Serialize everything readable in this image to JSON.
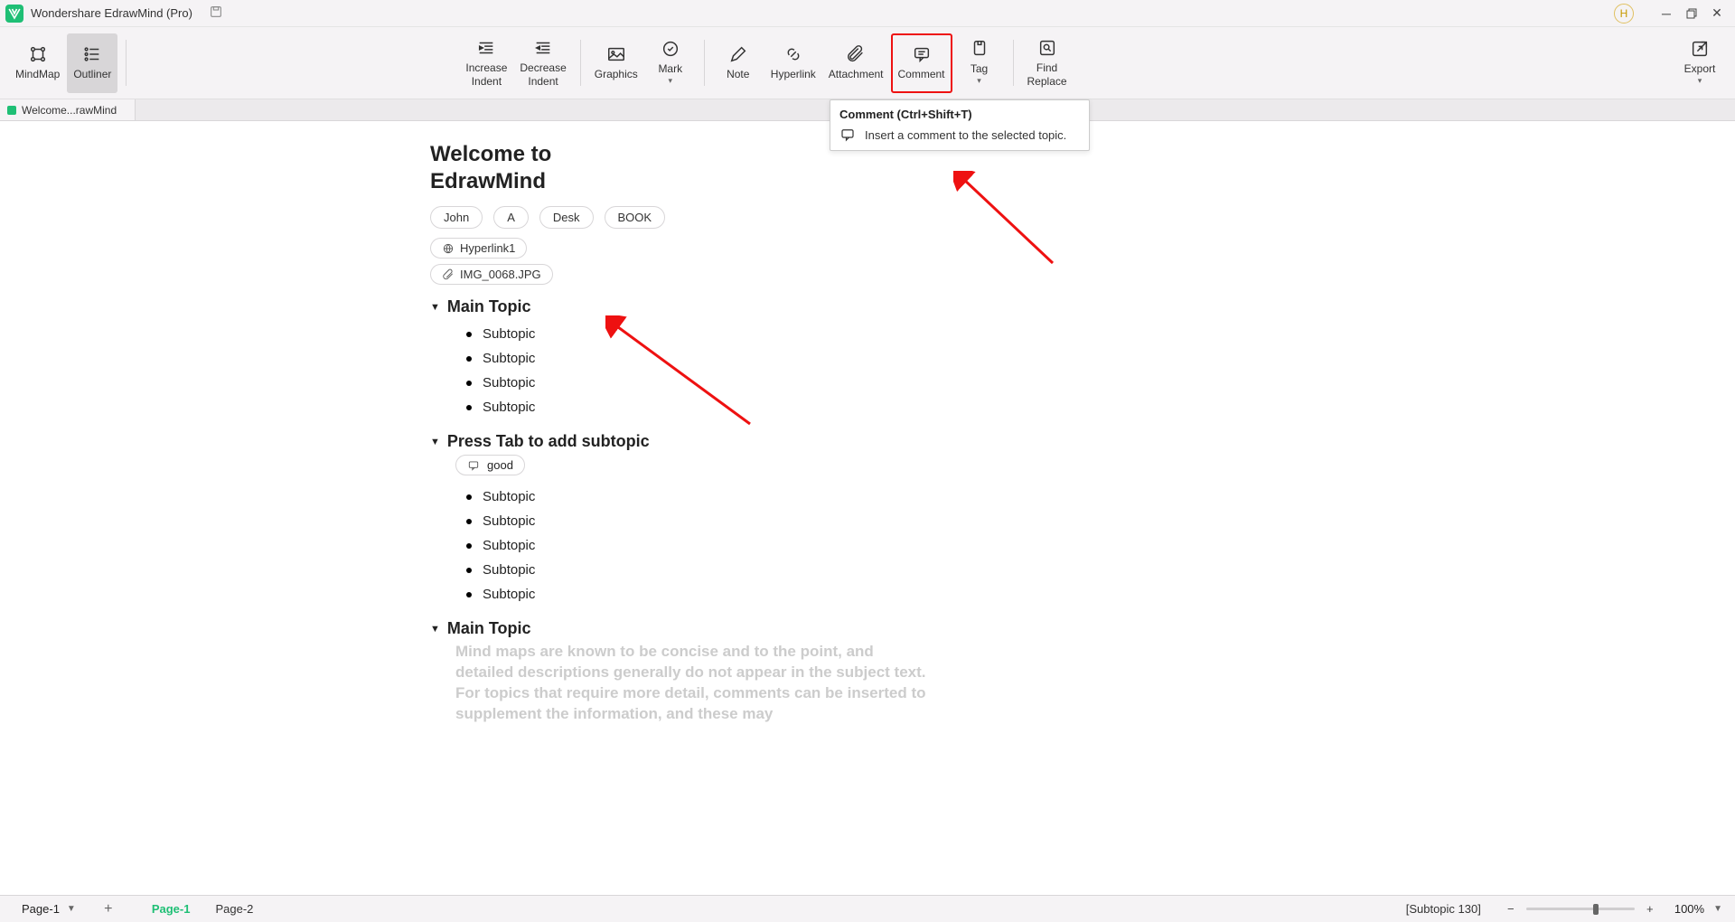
{
  "titlebar": {
    "app": "Wondershare EdrawMind (Pro)",
    "avatar": "H"
  },
  "toolbar": {
    "mindmap": "MindMap",
    "outliner": "Outliner",
    "increase_indent": "Increase\nIndent",
    "decrease_indent": "Decrease\nIndent",
    "graphics": "Graphics",
    "mark": "Mark",
    "note": "Note",
    "hyperlink": "Hyperlink",
    "attachment": "Attachment",
    "comment": "Comment",
    "tag": "Tag",
    "find_replace": "Find\nReplace",
    "export": "Export"
  },
  "doctab": "Welcome...rawMind",
  "tooltip": {
    "title": "Comment  (Ctrl+Shift+T)",
    "body": "Insert a comment to the selected topic."
  },
  "doc": {
    "title_line1": "Welcome to",
    "title_line2": "EdrawMind",
    "pills": [
      "John",
      "A",
      "Desk",
      "BOOK"
    ],
    "hyperlink": "Hyperlink1",
    "attachment": "IMG_0068.JPG",
    "topic1": {
      "title": "Main Topic",
      "items": [
        "Subtopic",
        "Subtopic",
        "Subtopic",
        "Subtopic"
      ]
    },
    "topic2": {
      "title": "Press Tab to add subtopic",
      "note": "good",
      "items": [
        "Subtopic",
        "Subtopic",
        "Subtopic",
        "Subtopic",
        "Subtopic"
      ]
    },
    "topic3": {
      "title": "Main Topic",
      "para": "Mind maps are known to be concise and to the point, and detailed descriptions generally do not appear in the subject text. For topics that require more detail, comments can be inserted to supplement the information, and these may"
    }
  },
  "bottom": {
    "page_selector": "Page-1",
    "tabs": [
      "Page-1",
      "Page-2"
    ],
    "active_tab": 0,
    "status": "[Subtopic 130]",
    "zoom": "100%",
    "zoom_pos_pct": 65
  }
}
